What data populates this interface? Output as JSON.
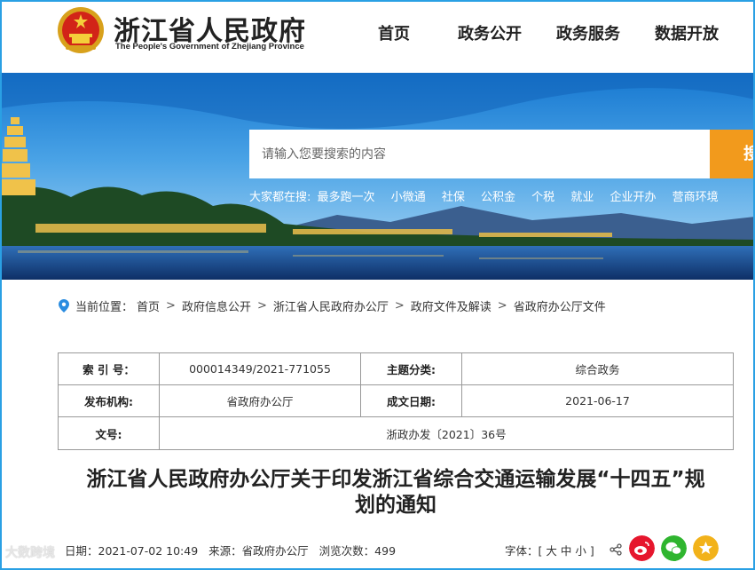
{
  "header": {
    "site_title": "浙江省人民政府",
    "site_subtitle": "The People's Government of Zhejiang Province",
    "nav": [
      "首页",
      "政务公开",
      "政务服务",
      "数据开放"
    ]
  },
  "search": {
    "placeholder": "请输入您要搜索的内容",
    "button_label": "搜",
    "hot_prefix": "大家都在搜:",
    "hot_terms": [
      "最多跑一次",
      "小微通",
      "社保",
      "公积金",
      "个税",
      "就业",
      "企业开办",
      "营商环境"
    ]
  },
  "breadcrumb": {
    "prefix": "当前位置：",
    "items": [
      "首页",
      "政府信息公开",
      "浙江省人民政府办公厅",
      "政府文件及解读",
      "省政府办公厅文件"
    ]
  },
  "meta": {
    "index_label": "索 引 号：",
    "index_value": "000014349/2021-771055",
    "topic_label": "主题分类:",
    "topic_value": "综合政务",
    "issuer_label": "发布机构:",
    "issuer_value": "省政府办公厅",
    "date_label": "成文日期:",
    "date_value": "2021-06-17",
    "docno_label": "文号:",
    "docno_value": "浙政办发〔2021〕36号"
  },
  "doc": {
    "title": "浙江省人民政府办公厅关于印发浙江省综合交通运输发展“十四五”规划的通知"
  },
  "info": {
    "date_label": "日期：",
    "date_value": "2021-07-02 10:49",
    "source_label": "来源：",
    "source_value": "省政府办公厅",
    "views_label": "浏览次数：",
    "views_value": "499"
  },
  "fontsize": {
    "label": "字体：[",
    "large": "大",
    "medium": "中",
    "small": "小",
    "close": "]"
  },
  "watermark": "大数跨境",
  "colors": {
    "frame": "#2aa0e4",
    "search_button": "#f29a1c",
    "weibo": "#e6162d",
    "wechat": "#2fb52f",
    "favorite": "#f2b21a"
  }
}
